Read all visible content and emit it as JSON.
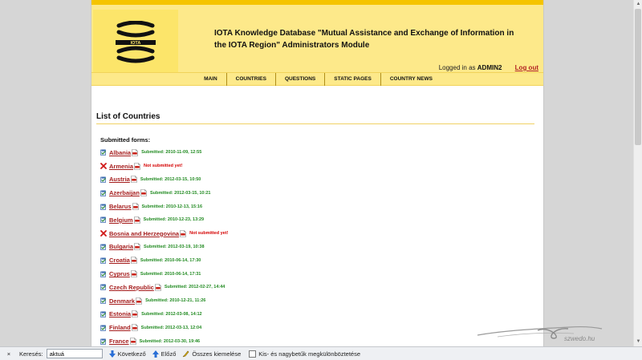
{
  "header": {
    "title": "IOTA Knowledge Database \"Mutual Assistance and Exchange of Information in the IOTA Region\" Administrators Module",
    "logo_text": "IOTA",
    "logged_in_prefix": "Logged in as",
    "username": "ADMIN2",
    "logout_label": "Log out"
  },
  "nav": [
    {
      "label": "MAIN"
    },
    {
      "label": "COUNTRIES"
    },
    {
      "label": "QUESTIONS"
    },
    {
      "label": "STATIC PAGES"
    },
    {
      "label": "COUNTRY NEWS"
    }
  ],
  "main": {
    "heading": "List of Countries",
    "subheading": "Submitted forms:",
    "countries": [
      {
        "name": "Albania",
        "submitted": true,
        "status": "Submitted: 2010-11-09, 12:55"
      },
      {
        "name": "Armenia",
        "submitted": false,
        "status": "Not submitted yet!"
      },
      {
        "name": "Austria",
        "submitted": true,
        "status": "Submitted: 2012-03-15, 10:50"
      },
      {
        "name": "Azerbaijan",
        "submitted": true,
        "status": "Submitted: 2012-03-15, 10:21"
      },
      {
        "name": "Belarus",
        "submitted": true,
        "status": "Submitted: 2010-12-13, 15:16"
      },
      {
        "name": "Belgium",
        "submitted": true,
        "status": "Submitted: 2010-12-23, 13:29"
      },
      {
        "name": "Bosnia and Herzegovina",
        "submitted": false,
        "status": "Not submitted yet!"
      },
      {
        "name": "Bulgaria",
        "submitted": true,
        "status": "Submitted: 2012-03-19, 10:38"
      },
      {
        "name": "Croatia",
        "submitted": true,
        "status": "Submitted: 2010-06-14, 17:30"
      },
      {
        "name": "Cyprus",
        "submitted": true,
        "status": "Submitted: 2010-06-14, 17:31"
      },
      {
        "name": "Czech Republic",
        "submitted": true,
        "status": "Submitted: 2012-02-27, 14:44"
      },
      {
        "name": "Denmark",
        "submitted": true,
        "status": "Submitted: 2010-12-21, 11:26"
      },
      {
        "name": "Estonia",
        "submitted": true,
        "status": "Submitted: 2012-03-08, 14:12"
      },
      {
        "name": "Finland",
        "submitted": true,
        "status": "Submitted: 2012-03-13, 12:04"
      },
      {
        "name": "France",
        "submitted": true,
        "status": "Submitted: 2012-03-30, 19:46"
      }
    ]
  },
  "watermark": {
    "text": "szwedo.hu"
  },
  "findbar": {
    "close_label": "×",
    "search_label": "Keresés:",
    "search_value": "aktuá",
    "next_label": "Következő",
    "prev_label": "Előző",
    "highlight_label": "Összes kiemelése",
    "match_case_label": "Kis- és nagybetűk megkülönböztetése"
  },
  "colors": {
    "header_bg": "#fde98a",
    "header_top": "#f5c400",
    "link_red": "#a51d1d",
    "ok_green": "#228b22",
    "error_red": "#d40000"
  }
}
